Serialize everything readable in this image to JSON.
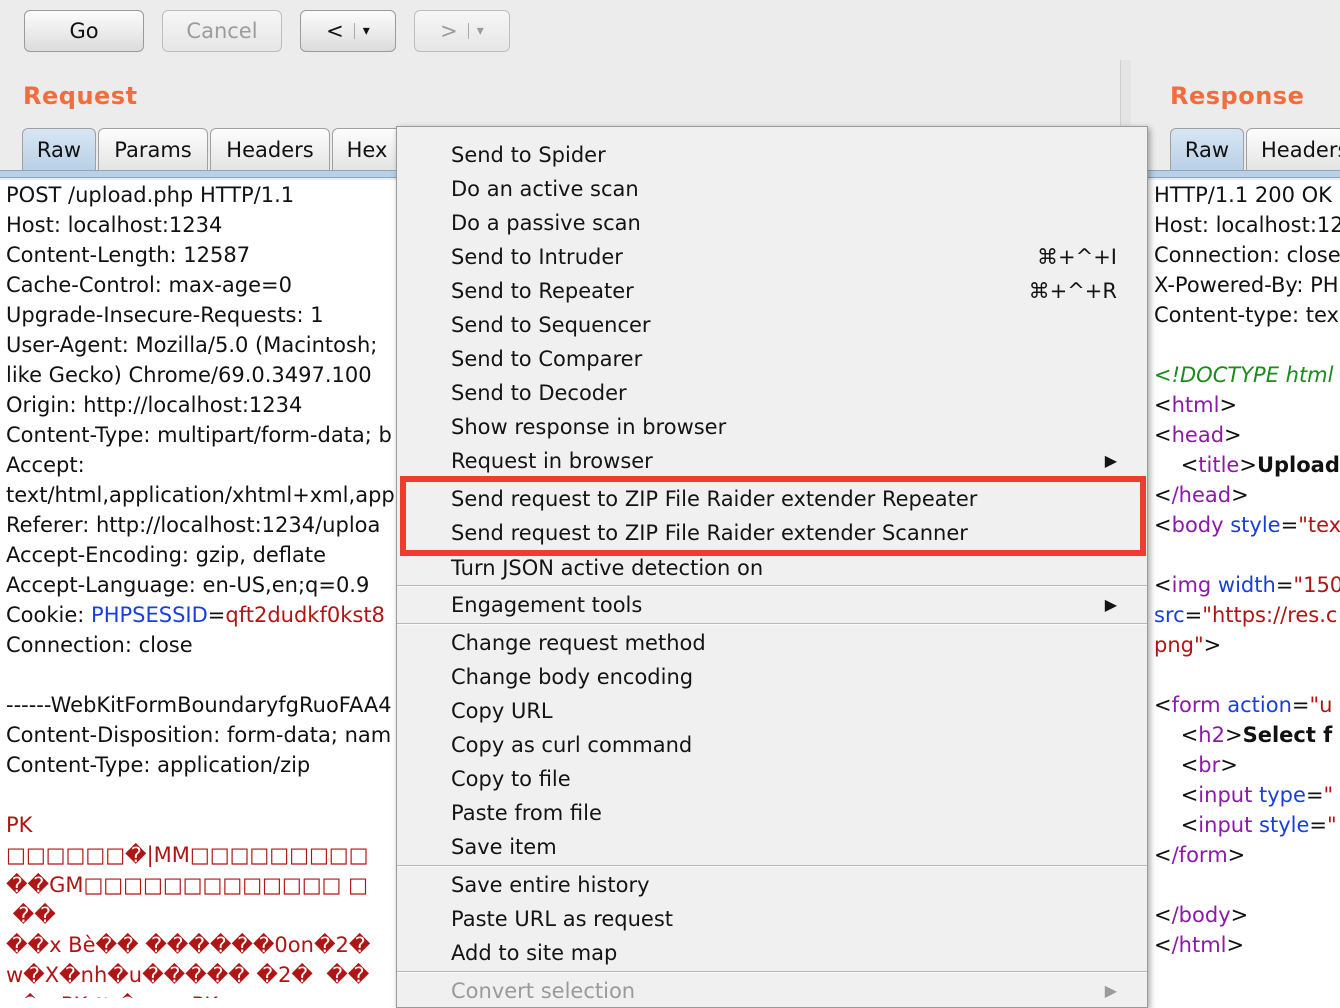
{
  "toolbar": {
    "go": "Go",
    "cancel": "Cancel",
    "back": "<",
    "forward": ">",
    "dropdown": "▾"
  },
  "request": {
    "title": "Request",
    "tabs": [
      "Raw",
      "Params",
      "Headers",
      "Hex"
    ],
    "lines": [
      "POST /upload.php HTTP/1.1",
      "Host: localhost:1234",
      "Content-Length: 12587",
      "Cache-Control: max-age=0",
      "Upgrade-Insecure-Requests: 1",
      "User-Agent: Mozilla/5.0 (Macintosh;",
      "like Gecko) Chrome/69.0.3497.100",
      "Origin: http://localhost:1234",
      "Content-Type: multipart/form-data; b",
      "Accept:",
      "text/html,application/xhtml+xml,app",
      "Referer: http://localhost:1234/uploa",
      "Accept-Encoding: gzip, deflate",
      "Accept-Language: en-US,en;q=0.9"
    ],
    "cookie_label": "Cookie: ",
    "cookie_name": "PHPSESSID",
    "cookie_eq": "=",
    "cookie_value": "qft2dudkf0kst8",
    "connection": "Connection: close",
    "boundary": "------WebKitFormBoundaryfgRuoFAA4",
    "disposition": "Content-Disposition: form-data; nam",
    "ctype": "Content-Type: application/zip",
    "binary": [
      "PK",
      "□□□□□□�|MM□□□□□□□□□",
      "��GM□□□□□□□□□□□□□ □",
      " ��",
      "��x Bè�� ������0on�2�",
      "w�X�nh�u����� �2�  ��",
      "  �   PK 𝕽 �        PK      "
    ]
  },
  "response": {
    "title": "Response",
    "tabs": [
      "Raw",
      "Headers"
    ],
    "lines": [
      "HTTP/1.1 200 OK",
      "Host: localhost:12",
      "Connection: close",
      "X-Powered-By: PH",
      "Content-type: tex"
    ],
    "html": {
      "doctype": "<!DOCTYPE html",
      "html_open": "html",
      "head_open": "head",
      "title_tag": "title",
      "title_text": "Upload",
      "head_close": "/head",
      "body_tag": "body",
      "body_attr": "style",
      "body_val": "\"tex",
      "img_tag": "img",
      "img_attr": "width",
      "img_val": "\"150",
      "src_attr": "src",
      "src_val": "\"https://res.c",
      "png": "png\"",
      "form_tag": "form",
      "form_attr": "action",
      "form_val": "\"u",
      "h2_tag": "h2",
      "h2_text": "Select f",
      "br_tag": "br",
      "input_tag": "input",
      "input1_attr": "type",
      "input1_val": "\"",
      "input2_attr": "style",
      "input2_val": "\"",
      "form_close": "/form",
      "body_close": "/body",
      "html_close": "/html"
    }
  },
  "menu": {
    "items": [
      {
        "label": "Send to Spider"
      },
      {
        "label": "Do an active scan"
      },
      {
        "label": "Do a passive scan"
      },
      {
        "label": "Send to Intruder",
        "shortcut": "⌘+^+I"
      },
      {
        "label": "Send to Repeater",
        "shortcut": "⌘+^+R"
      },
      {
        "label": "Send to Sequencer"
      },
      {
        "label": "Send to Comparer"
      },
      {
        "label": "Send to Decoder"
      },
      {
        "label": "Show response in browser"
      },
      {
        "label": "Request in browser"
      },
      {
        "label": "Send request to ZIP File Raider extender Repeater"
      },
      {
        "label": "Send request to ZIP File Raider extender Scanner"
      },
      {
        "label": "Turn JSON active detection on"
      },
      {
        "label": "Engagement tools"
      },
      {
        "label": "Change request method"
      },
      {
        "label": "Change body encoding"
      },
      {
        "label": "Copy URL"
      },
      {
        "label": "Copy as curl command"
      },
      {
        "label": "Copy to file"
      },
      {
        "label": "Paste from file"
      },
      {
        "label": "Save item"
      },
      {
        "label": "Save entire history"
      },
      {
        "label": "Paste URL as request"
      },
      {
        "label": "Add to site map"
      },
      {
        "label": "Convert selection"
      }
    ],
    "submenu_arrow": "▶"
  },
  "colors": {
    "accent": "#f26d3d",
    "highlight": "#f03c2c",
    "keyword_blue": "#1a3fd8",
    "value_red": "#b01515",
    "tag_purple": "#8b1aa8"
  }
}
